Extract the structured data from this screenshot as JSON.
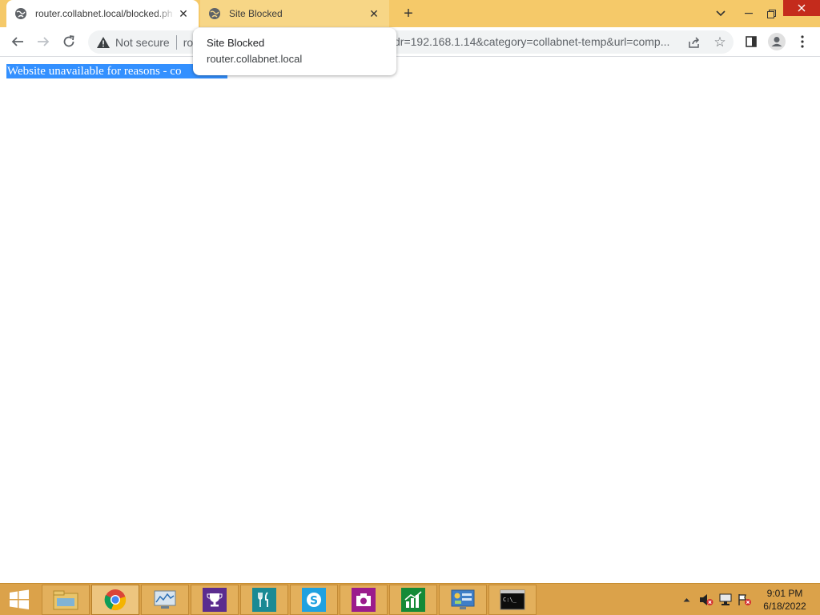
{
  "browser": {
    "tabs": [
      {
        "title": "router.collabnet.local/blocked.ph",
        "active": true
      },
      {
        "title": "Site Blocked",
        "active": false
      }
    ],
    "new_tab_label": "+",
    "address_bar": {
      "security_label": "Not secure",
      "url_prefix": "ro",
      "url_visible_tail": "dr=192.168.1.14&category=collabnet-temp&url=comp..."
    }
  },
  "hover_card": {
    "title": "Site Blocked",
    "domain": "router.collabnet.local"
  },
  "page": {
    "selected_text": "Website unavailable for reasons - co"
  },
  "taskbar": {
    "apps": [
      "file-explorer",
      "chrome",
      "resource-monitor",
      "trophy-app",
      "food-app",
      "skype",
      "camera-app",
      "finance-app",
      "control-panel",
      "command-prompt"
    ],
    "clock_time": "9:01 PM",
    "clock_date": "6/18/2022"
  },
  "colors": {
    "tabstrip": "#f5c969",
    "taskbar": "#dba24a",
    "selection": "#3390ff"
  }
}
